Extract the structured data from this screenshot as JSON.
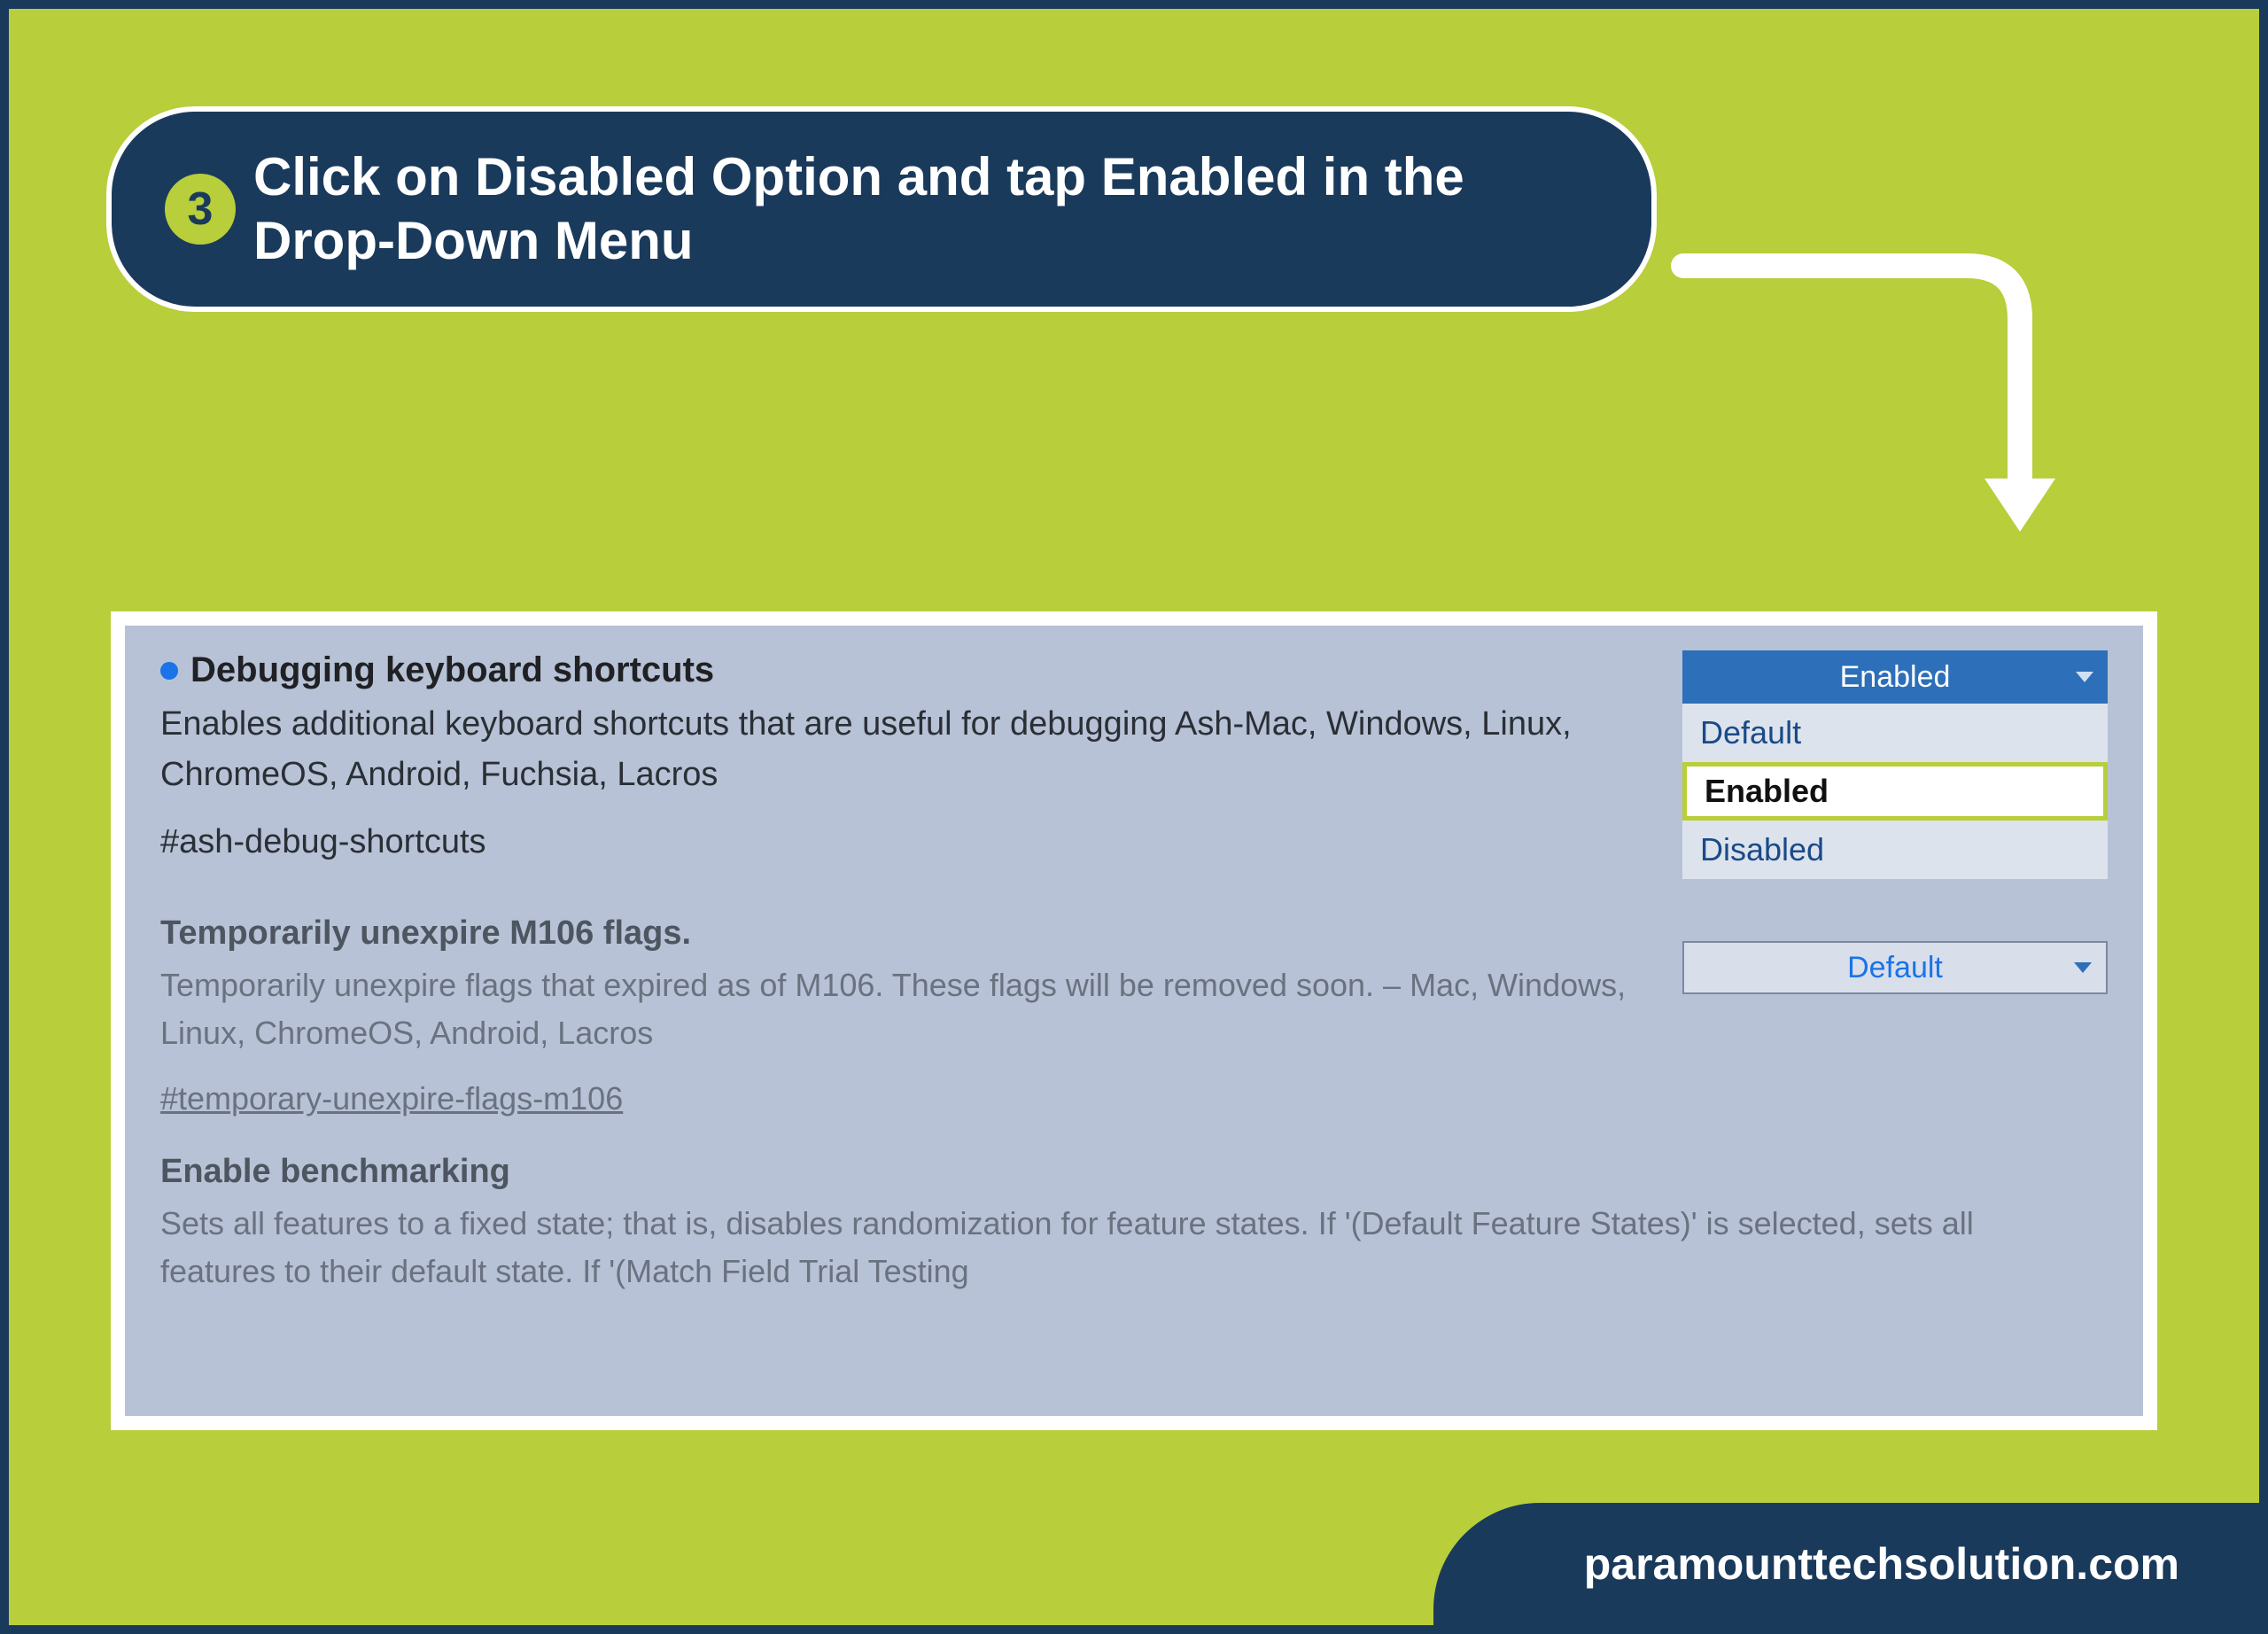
{
  "step": {
    "number": "3",
    "title": "Click on Disabled Option and tap Enabled in the Drop-Down Menu"
  },
  "flags": [
    {
      "title": "Debugging keyboard shortcuts",
      "desc": "Enables additional keyboard shortcuts that are useful for debugging Ash-Mac, Windows, Linux, ChromeOS, Android, Fuchsia, Lacros",
      "hash": "#ash-debug-shortcuts",
      "dropdown": {
        "selected": "Enabled",
        "options": [
          "Default",
          "Enabled",
          "Disabled"
        ],
        "highlighted": "Enabled",
        "open": true
      }
    },
    {
      "title": "Temporarily unexpire M106 flags.",
      "desc": "Temporarily unexpire flags that expired as of M106. These flags will be removed soon. – Mac, Windows, Linux, ChromeOS, Android, Lacros",
      "hash": "#temporary-unexpire-flags-m106",
      "dropdown": {
        "selected": "Default",
        "open": false
      }
    },
    {
      "title": "Enable benchmarking",
      "desc": "Sets all features to a fixed state; that is, disables randomization for feature states. If '(Default Feature States)' is selected, sets all features to their default state. If '(Match Field Trial Testing",
      "hash": "",
      "dropdown": null
    }
  ],
  "footer": "paramounttechsolution.com"
}
